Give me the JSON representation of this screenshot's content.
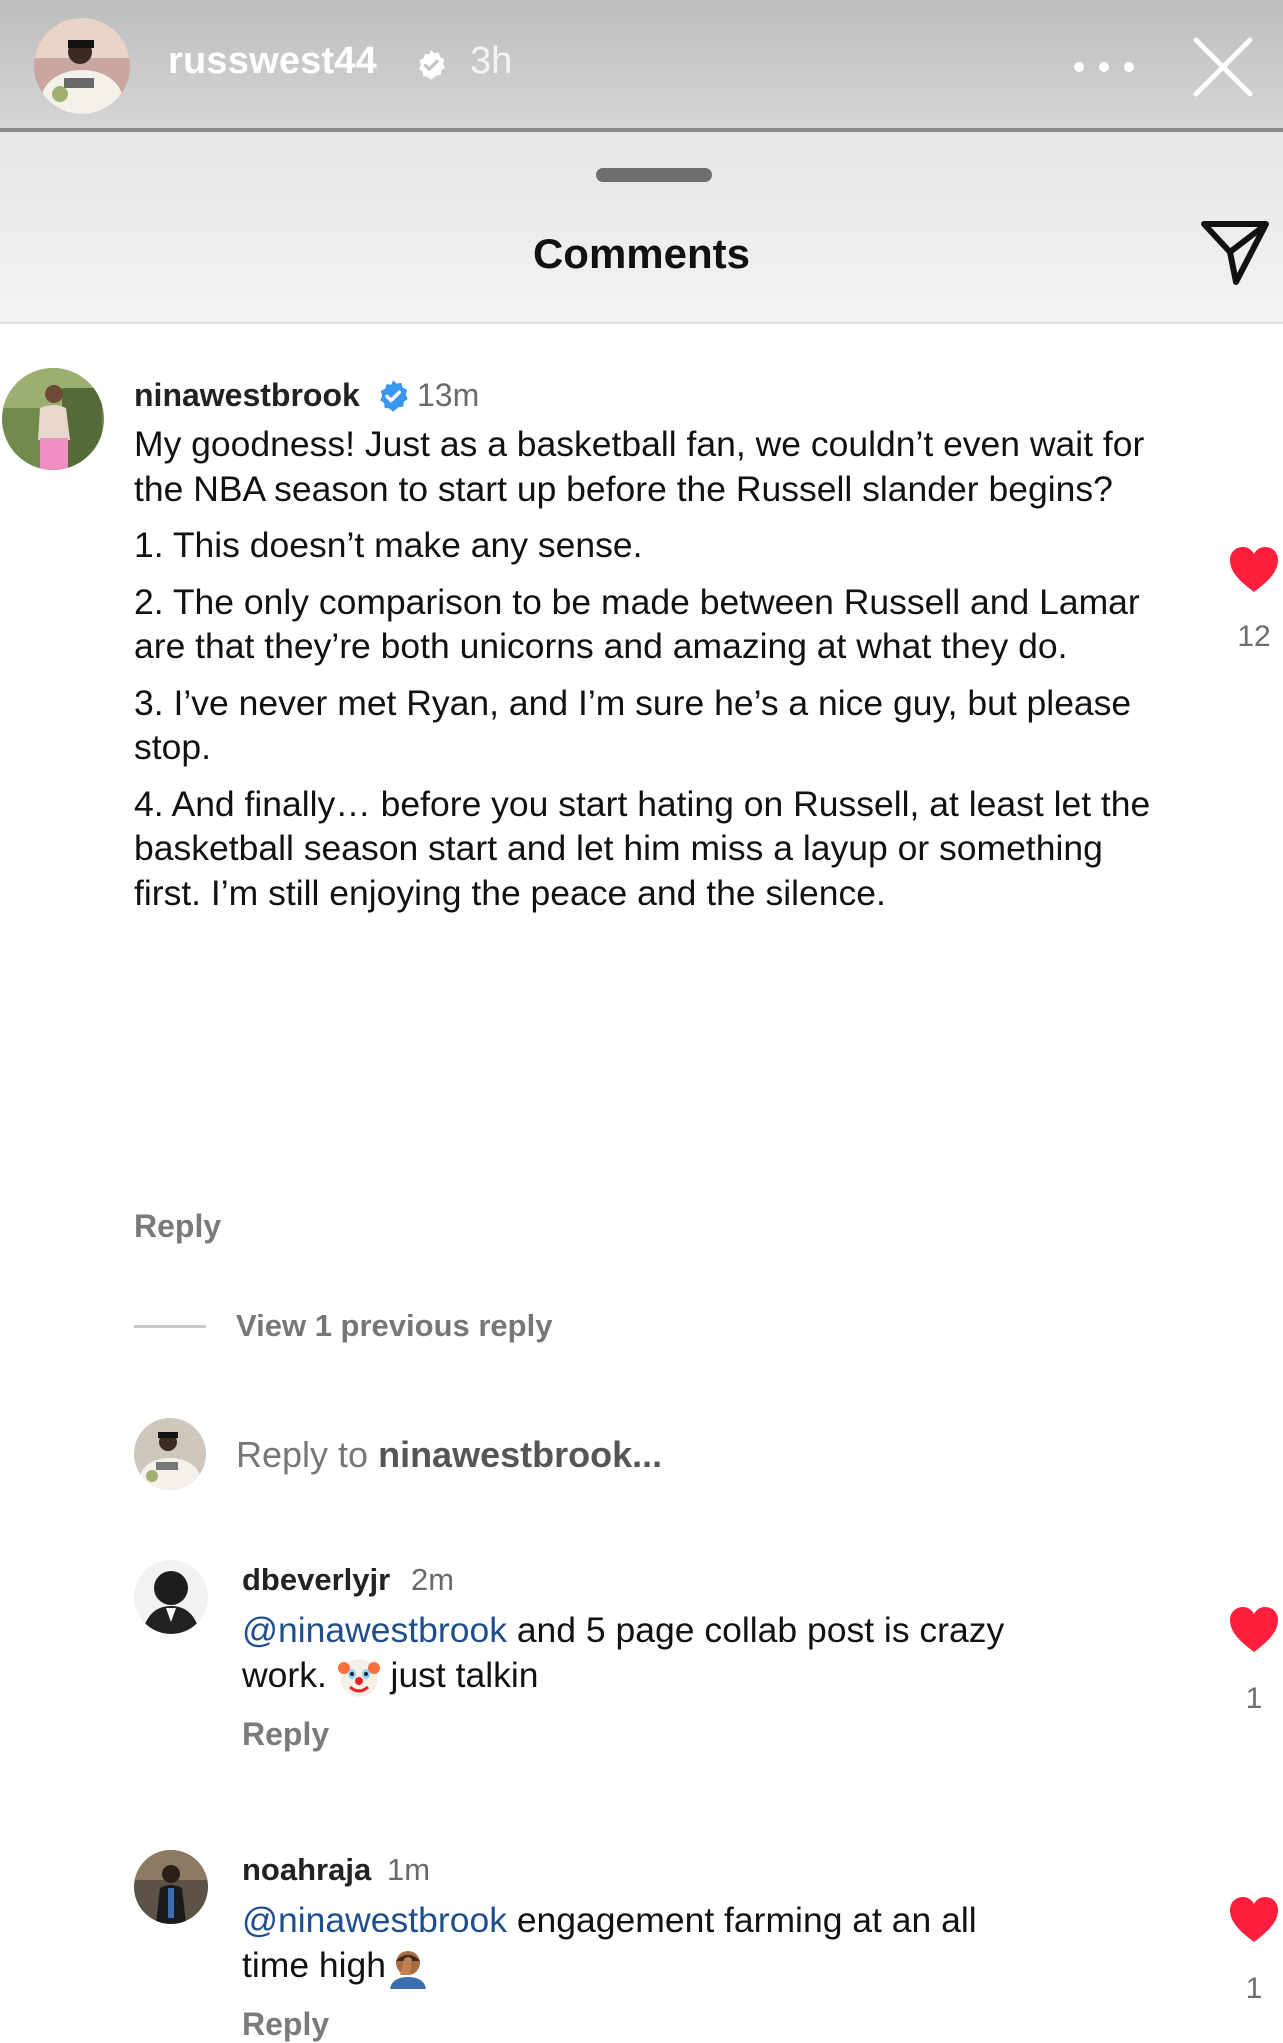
{
  "story": {
    "username": "russwest44",
    "time": "3h"
  },
  "sheet": {
    "title": "Comments"
  },
  "comments": [
    {
      "username": "ninawestbrook",
      "verified": true,
      "time": "13m",
      "paragraphs": [
        "My goodness! Just as a basketball fan, we couldn’t even wait for the NBA season to start up before the Russell slander begins?",
        "1. This doesn’t make any sense.",
        "2. The only comparison to be made between Russell and Lamar are that they’re both unicorns and amazing at what they do.",
        "3. I’ve never met Ryan, and I’m sure he’s a nice guy, but please stop.",
        "4. And finally… before you start hating on Russell, at least let the basketball season start and let him miss a layup or something first. I’m still enjoying the peace and the silence."
      ],
      "reply_label": "Reply",
      "likes": "12"
    },
    {
      "username": "dbeverlyjr",
      "time": "2m",
      "mention": "@ninawestbrook",
      "text_line1": " and 5 page collab post is crazy",
      "text_line2_a": "work. ",
      "emoji": "clown-face-emoji",
      "text_line2_b": " just talkin",
      "reply_label": "Reply",
      "likes": "1"
    },
    {
      "username": "noahraja",
      "time": "1m",
      "mention": "@ninawestbrook",
      "text_line1": " engagement farming at an all",
      "text_line2_a": "time high",
      "emoji": "facepalm-emoji",
      "reply_label": "Reply",
      "likes": "1"
    }
  ],
  "view_replies": {
    "label": "View 1 previous reply"
  },
  "reply_input": {
    "prefix": "Reply to ",
    "target": "ninawestbrook..."
  },
  "colors": {
    "heart": "#ff1f3d",
    "verified": "#3897f0",
    "mention": "#1f4e8c"
  }
}
